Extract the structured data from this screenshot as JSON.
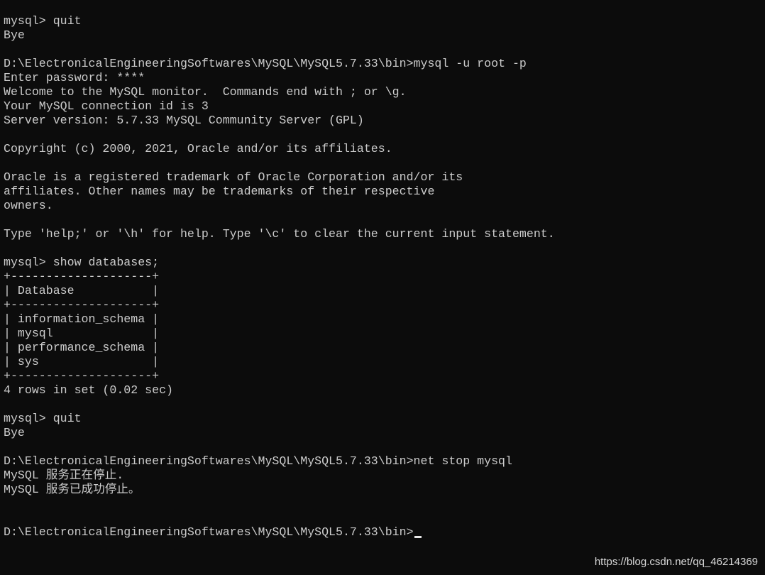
{
  "terminal": {
    "lines": [
      "mysql> quit",
      "Bye",
      "",
      "D:\\ElectronicalEngineeringSoftwares\\MySQL\\MySQL5.7.33\\bin>mysql -u root -p",
      "Enter password: ****",
      "Welcome to the MySQL monitor.  Commands end with ; or \\g.",
      "Your MySQL connection id is 3",
      "Server version: 5.7.33 MySQL Community Server (GPL)",
      "",
      "Copyright (c) 2000, 2021, Oracle and/or its affiliates.",
      "",
      "Oracle is a registered trademark of Oracle Corporation and/or its",
      "affiliates. Other names may be trademarks of their respective",
      "owners.",
      "",
      "Type 'help;' or '\\h' for help. Type '\\c' to clear the current input statement.",
      "",
      "mysql> show databases;",
      "+--------------------+",
      "| Database           |",
      "+--------------------+",
      "| information_schema |",
      "| mysql              |",
      "| performance_schema |",
      "| sys                |",
      "+--------------------+",
      "4 rows in set (0.02 sec)",
      "",
      "mysql> quit",
      "Bye",
      "",
      "D:\\ElectronicalEngineeringSoftwares\\MySQL\\MySQL5.7.33\\bin>net stop mysql",
      "MySQL 服务正在停止.",
      "MySQL 服务已成功停止。",
      "",
      ""
    ],
    "prompt": "D:\\ElectronicalEngineeringSoftwares\\MySQL\\MySQL5.7.33\\bin>"
  },
  "watermark": "https://blog.csdn.net/qq_46214369",
  "colors": {
    "background": "#0c0c0c",
    "text": "#cccccc"
  }
}
